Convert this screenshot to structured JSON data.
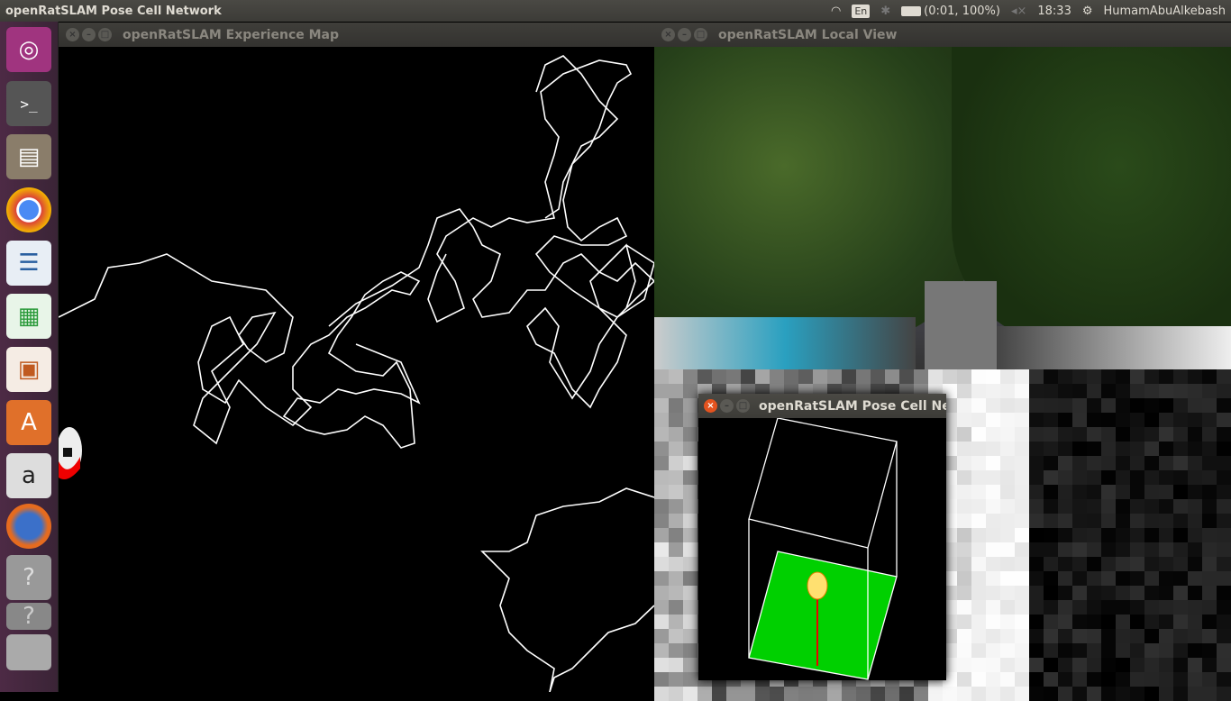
{
  "topbar": {
    "app_title": "openRatSLAM Pose Cell Network",
    "keyboard": "En",
    "battery": "(0:01, 100%)",
    "time": "18:33",
    "user": "HumamAbuAlkebash",
    "icons": [
      "wifi-icon",
      "bluetooth-icon",
      "battery-icon",
      "volume-muted-icon",
      "power-icon"
    ]
  },
  "launcher": {
    "items": [
      "ubuntu-dash",
      "terminal",
      "files",
      "chrome",
      "libreoffice-writer",
      "libreoffice-calc",
      "libreoffice-impress",
      "software-center",
      "amazon",
      "firefox",
      "unknown-app",
      "unknown-app",
      "workspace-switcher"
    ]
  },
  "windows": {
    "experience_map": {
      "title": "openRatSLAM Experience Map"
    },
    "local_view": {
      "title": "openRatSLAM Local View"
    },
    "pose_cell": {
      "title": "openRatSLAM Pose Cell Ne"
    }
  },
  "colors": {
    "accent": "#e3531f",
    "pose_green": "#00e000",
    "path": "#ffffff"
  }
}
